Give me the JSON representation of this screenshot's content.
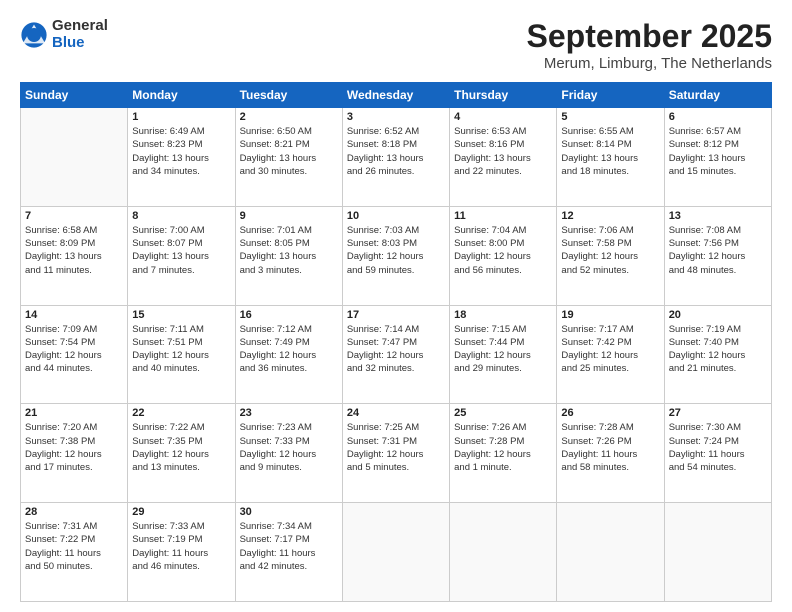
{
  "header": {
    "logo": {
      "general": "General",
      "blue": "Blue"
    },
    "title": "September 2025",
    "location": "Merum, Limburg, The Netherlands"
  },
  "days_of_week": [
    "Sunday",
    "Monday",
    "Tuesday",
    "Wednesday",
    "Thursday",
    "Friday",
    "Saturday"
  ],
  "weeks": [
    [
      {
        "date": "",
        "info": ""
      },
      {
        "date": "1",
        "info": "Sunrise: 6:49 AM\nSunset: 8:23 PM\nDaylight: 13 hours\nand 34 minutes."
      },
      {
        "date": "2",
        "info": "Sunrise: 6:50 AM\nSunset: 8:21 PM\nDaylight: 13 hours\nand 30 minutes."
      },
      {
        "date": "3",
        "info": "Sunrise: 6:52 AM\nSunset: 8:18 PM\nDaylight: 13 hours\nand 26 minutes."
      },
      {
        "date": "4",
        "info": "Sunrise: 6:53 AM\nSunset: 8:16 PM\nDaylight: 13 hours\nand 22 minutes."
      },
      {
        "date": "5",
        "info": "Sunrise: 6:55 AM\nSunset: 8:14 PM\nDaylight: 13 hours\nand 18 minutes."
      },
      {
        "date": "6",
        "info": "Sunrise: 6:57 AM\nSunset: 8:12 PM\nDaylight: 13 hours\nand 15 minutes."
      }
    ],
    [
      {
        "date": "7",
        "info": "Sunrise: 6:58 AM\nSunset: 8:09 PM\nDaylight: 13 hours\nand 11 minutes."
      },
      {
        "date": "8",
        "info": "Sunrise: 7:00 AM\nSunset: 8:07 PM\nDaylight: 13 hours\nand 7 minutes."
      },
      {
        "date": "9",
        "info": "Sunrise: 7:01 AM\nSunset: 8:05 PM\nDaylight: 13 hours\nand 3 minutes."
      },
      {
        "date": "10",
        "info": "Sunrise: 7:03 AM\nSunset: 8:03 PM\nDaylight: 12 hours\nand 59 minutes."
      },
      {
        "date": "11",
        "info": "Sunrise: 7:04 AM\nSunset: 8:00 PM\nDaylight: 12 hours\nand 56 minutes."
      },
      {
        "date": "12",
        "info": "Sunrise: 7:06 AM\nSunset: 7:58 PM\nDaylight: 12 hours\nand 52 minutes."
      },
      {
        "date": "13",
        "info": "Sunrise: 7:08 AM\nSunset: 7:56 PM\nDaylight: 12 hours\nand 48 minutes."
      }
    ],
    [
      {
        "date": "14",
        "info": "Sunrise: 7:09 AM\nSunset: 7:54 PM\nDaylight: 12 hours\nand 44 minutes."
      },
      {
        "date": "15",
        "info": "Sunrise: 7:11 AM\nSunset: 7:51 PM\nDaylight: 12 hours\nand 40 minutes."
      },
      {
        "date": "16",
        "info": "Sunrise: 7:12 AM\nSunset: 7:49 PM\nDaylight: 12 hours\nand 36 minutes."
      },
      {
        "date": "17",
        "info": "Sunrise: 7:14 AM\nSunset: 7:47 PM\nDaylight: 12 hours\nand 32 minutes."
      },
      {
        "date": "18",
        "info": "Sunrise: 7:15 AM\nSunset: 7:44 PM\nDaylight: 12 hours\nand 29 minutes."
      },
      {
        "date": "19",
        "info": "Sunrise: 7:17 AM\nSunset: 7:42 PM\nDaylight: 12 hours\nand 25 minutes."
      },
      {
        "date": "20",
        "info": "Sunrise: 7:19 AM\nSunset: 7:40 PM\nDaylight: 12 hours\nand 21 minutes."
      }
    ],
    [
      {
        "date": "21",
        "info": "Sunrise: 7:20 AM\nSunset: 7:38 PM\nDaylight: 12 hours\nand 17 minutes."
      },
      {
        "date": "22",
        "info": "Sunrise: 7:22 AM\nSunset: 7:35 PM\nDaylight: 12 hours\nand 13 minutes."
      },
      {
        "date": "23",
        "info": "Sunrise: 7:23 AM\nSunset: 7:33 PM\nDaylight: 12 hours\nand 9 minutes."
      },
      {
        "date": "24",
        "info": "Sunrise: 7:25 AM\nSunset: 7:31 PM\nDaylight: 12 hours\nand 5 minutes."
      },
      {
        "date": "25",
        "info": "Sunrise: 7:26 AM\nSunset: 7:28 PM\nDaylight: 12 hours\nand 1 minute."
      },
      {
        "date": "26",
        "info": "Sunrise: 7:28 AM\nSunset: 7:26 PM\nDaylight: 11 hours\nand 58 minutes."
      },
      {
        "date": "27",
        "info": "Sunrise: 7:30 AM\nSunset: 7:24 PM\nDaylight: 11 hours\nand 54 minutes."
      }
    ],
    [
      {
        "date": "28",
        "info": "Sunrise: 7:31 AM\nSunset: 7:22 PM\nDaylight: 11 hours\nand 50 minutes."
      },
      {
        "date": "29",
        "info": "Sunrise: 7:33 AM\nSunset: 7:19 PM\nDaylight: 11 hours\nand 46 minutes."
      },
      {
        "date": "30",
        "info": "Sunrise: 7:34 AM\nSunset: 7:17 PM\nDaylight: 11 hours\nand 42 minutes."
      },
      {
        "date": "",
        "info": ""
      },
      {
        "date": "",
        "info": ""
      },
      {
        "date": "",
        "info": ""
      },
      {
        "date": "",
        "info": ""
      }
    ]
  ]
}
